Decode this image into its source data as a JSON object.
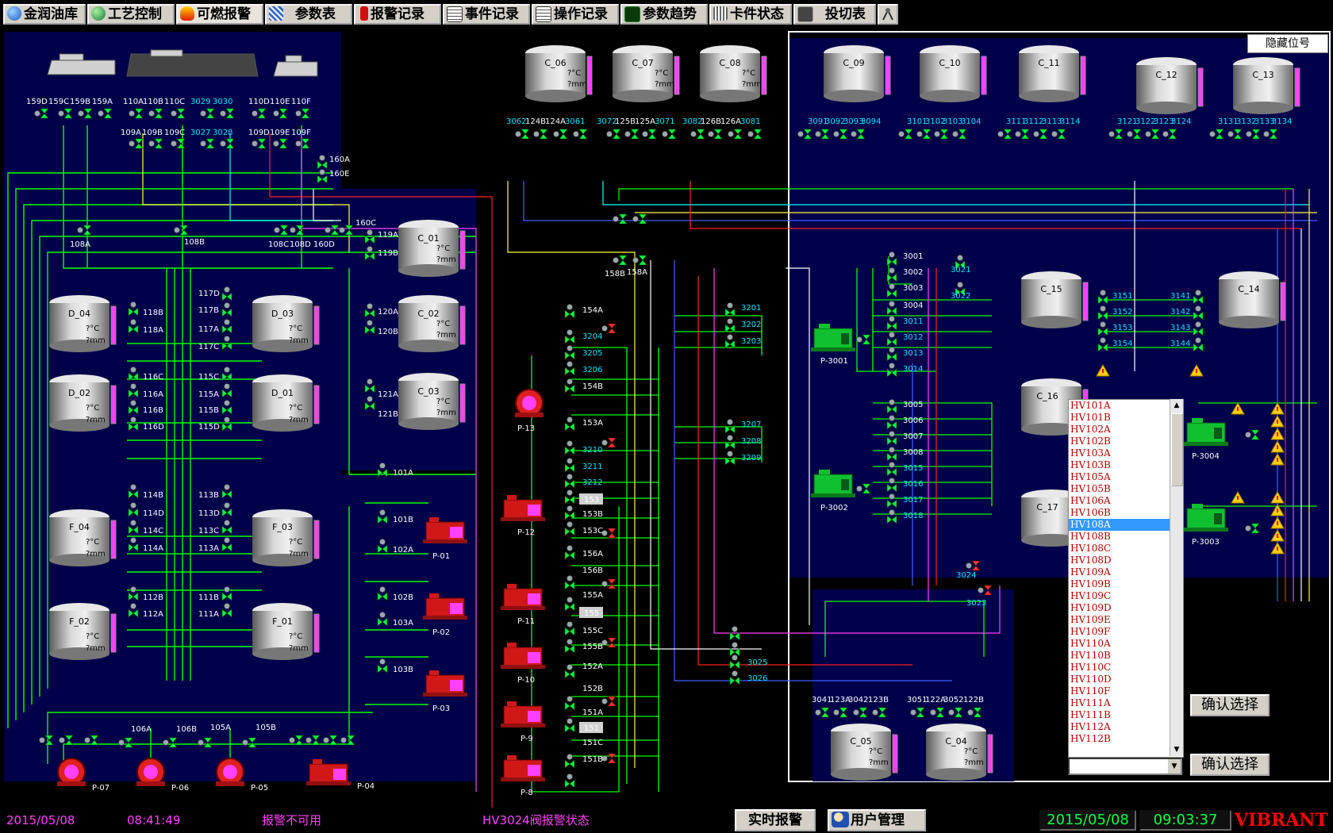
{
  "toolbar": {
    "tabs": [
      {
        "label": "金润油库",
        "icon": "globe-icon",
        "color": "#2b6fd6"
      },
      {
        "label": "工艺控制",
        "icon": "globe-icon",
        "color": "#2b8f3f"
      },
      {
        "label": "可燃报警",
        "icon": "fire-icon",
        "color": "#e03a10"
      },
      {
        "label": "参数表",
        "icon": "table-icon",
        "color": "#3a6ad0"
      },
      {
        "label": "报警记录",
        "icon": "alarm-icon",
        "color": "#d01010"
      },
      {
        "label": "事件记录",
        "icon": "document-icon",
        "color": "#555555"
      },
      {
        "label": "操作记录",
        "icon": "document-icon",
        "color": "#555555"
      },
      {
        "label": "参数趋势",
        "icon": "trend-icon",
        "color": "#1a7a1a"
      },
      {
        "label": "卡件状态",
        "icon": "rack-icon",
        "color": "#555555"
      },
      {
        "label": "投切表",
        "icon": "switch-icon",
        "color": "#444444"
      }
    ],
    "antenna_icon": "antenna-icon"
  },
  "panel": {
    "hide_tags_button": "隐藏位号",
    "confirm_button_1": "确认选择",
    "confirm_button_2": "确认选择",
    "tag_list": [
      "HV101A",
      "HV101B",
      "HV102A",
      "HV102B",
      "HV103A",
      "HV103B",
      "HV105A",
      "HV105B",
      "HV106A",
      "HV106B",
      "HV108A",
      "HV108B",
      "HV108C",
      "HV108D",
      "HV109A",
      "HV109B",
      "HV109C",
      "HV109D",
      "HV109E",
      "HV109F",
      "HV110A",
      "HV110B",
      "HV110C",
      "HV110D",
      "HV110F",
      "HV111A",
      "HV111B",
      "HV112A",
      "HV112B"
    ],
    "selected_tag": "HV108A",
    "combo_value": ""
  },
  "tanks": [
    {
      "name": "C_06",
      "temp": "?°C",
      "level": "?mm"
    },
    {
      "name": "C_07",
      "temp": "?°C",
      "level": "?mm"
    },
    {
      "name": "C_08",
      "temp": "?°C",
      "level": "?mm"
    },
    {
      "name": "C_09",
      "temp": "",
      "level": ""
    },
    {
      "name": "C_10",
      "temp": "",
      "level": ""
    },
    {
      "name": "C_11",
      "temp": "",
      "level": ""
    },
    {
      "name": "C_12",
      "temp": "",
      "level": ""
    },
    {
      "name": "C_13",
      "temp": "",
      "level": ""
    },
    {
      "name": "C_01",
      "temp": "?°C",
      "level": "?mm"
    },
    {
      "name": "C_02",
      "temp": "?°C",
      "level": "?mm"
    },
    {
      "name": "C_03",
      "temp": "?°C",
      "level": "?mm"
    },
    {
      "name": "D_04",
      "temp": "?°C",
      "level": "?mm"
    },
    {
      "name": "D_03",
      "temp": "?°C",
      "level": "?mm"
    },
    {
      "name": "D_02",
      "temp": "?°C",
      "level": "?mm"
    },
    {
      "name": "D_01",
      "temp": "?°C",
      "level": "?mm"
    },
    {
      "name": "F_04",
      "temp": "?°C",
      "level": "?mm"
    },
    {
      "name": "F_03",
      "temp": "?°C",
      "level": "?mm"
    },
    {
      "name": "F_02",
      "temp": "?°C",
      "level": "?mm"
    },
    {
      "name": "F_01",
      "temp": "?°C",
      "level": "?mm"
    },
    {
      "name": "C_15",
      "temp": "",
      "level": ""
    },
    {
      "name": "C_14",
      "temp": "",
      "level": ""
    },
    {
      "name": "C_16",
      "temp": "",
      "level": ""
    },
    {
      "name": "C_17",
      "temp": "",
      "level": ""
    },
    {
      "name": "C_05",
      "temp": "?°C",
      "level": "?mm"
    },
    {
      "name": "C_04",
      "temp": "?°C",
      "level": "?mm"
    }
  ],
  "pumps": [
    "P-07",
    "P-06",
    "P-05",
    "P-04",
    "P-01",
    "P-02",
    "P-03",
    "P-13",
    "P-12",
    "P-11",
    "P-10",
    "P-9",
    "P-8",
    "P-3001",
    "P-3002",
    "P-3004",
    "P-3003"
  ],
  "valve_labels": {
    "top_left_row1": [
      "159D",
      "159C",
      "159B",
      "159A",
      "110A",
      "110B",
      "110C",
      "3029",
      "3030",
      "110D",
      "110E",
      "110F"
    ],
    "top_left_row2": [
      "109A",
      "109B",
      "109C",
      "3027",
      "3028",
      "109D",
      "109E",
      "109F"
    ],
    "misc_left": [
      "160A",
      "160E",
      "160C",
      "108A",
      "108B",
      "108C",
      "108D",
      "160D",
      "119A",
      "119B",
      "120A",
      "120B",
      "121A",
      "121B"
    ],
    "tank_manifold": [
      "118B",
      "118A",
      "117D",
      "117B",
      "117A",
      "117C",
      "116C",
      "116A",
      "116B",
      "116D",
      "115C",
      "115A",
      "115B",
      "115D",
      "114B",
      "114D",
      "114C",
      "114A",
      "113B",
      "113D",
      "113C",
      "113A",
      "112B",
      "112A",
      "111B",
      "111A"
    ],
    "pump_out": [
      "101A",
      "101B",
      "102A",
      "102B",
      "103A",
      "103B"
    ],
    "bottom_left": [
      "106A",
      "106B",
      "105A",
      "105B"
    ],
    "top_mid": [
      "3062",
      "124B",
      "124A",
      "3061",
      "3072",
      "125B",
      "125A",
      "3071",
      "3082",
      "126B",
      "126A",
      "3081"
    ],
    "top_right": [
      "3091",
      "3092",
      "3093",
      "3094",
      "3101",
      "3102",
      "3103",
      "3104",
      "3111",
      "3112",
      "3113",
      "3114",
      "3121",
      "3122",
      "3123",
      "3124",
      "3131",
      "3132",
      "3133",
      "3134"
    ],
    "mid": [
      "158B",
      "158A",
      "154A",
      "3204",
      "3205",
      "3206",
      "154B",
      "153A",
      "3210",
      "3211",
      "3212",
      "153",
      "153B",
      "153C",
      "156A",
      "156B",
      "155A",
      "155",
      "155C",
      "155B",
      "152A",
      "152B",
      "151A",
      "151",
      "151C",
      "151B"
    ],
    "mid_right": [
      "3201",
      "3202",
      "3203",
      "3207",
      "3208",
      "3209",
      "3025",
      "3026"
    ],
    "right": [
      "3001",
      "3002",
      "3003",
      "3004",
      "3011",
      "3012",
      "3013",
      "3014",
      "3021",
      "3022",
      "3005",
      "3006",
      "3007",
      "3008",
      "3015",
      "3016",
      "3017",
      "3018",
      "3024",
      "3023",
      "3151",
      "3152",
      "3153",
      "3154",
      "3141",
      "3142",
      "3143",
      "3144"
    ],
    "bottom_right": [
      "3041",
      "123A",
      "3042",
      "123B",
      "3051",
      "122A",
      "3052",
      "122B"
    ]
  },
  "status": {
    "date_left": "2015/05/08",
    "time_left": "08:41:49",
    "alarm_state": "报警不可用",
    "valve_alarm": "HV3024阀报警状态",
    "realtime_alarm_button": "实时报警",
    "user_mgmt_button": "用户管理",
    "date_right": "2015/05/08",
    "time_right": "09:03:37",
    "brand": "VIBRANT"
  },
  "colors": {
    "pipe_green": "#00ff00",
    "pipe_red": "#ff2020",
    "pipe_yellow": "#ffff40",
    "pipe_blue": "#4060ff",
    "pipe_magenta": "#ff40ff",
    "pipe_white": "#ffffff",
    "pipe_cyan": "#00ffff",
    "area_navy": "#00004a",
    "tank_level": "#ff40ff",
    "status_green": "#00ff40",
    "brand_red": "#ff0000"
  }
}
